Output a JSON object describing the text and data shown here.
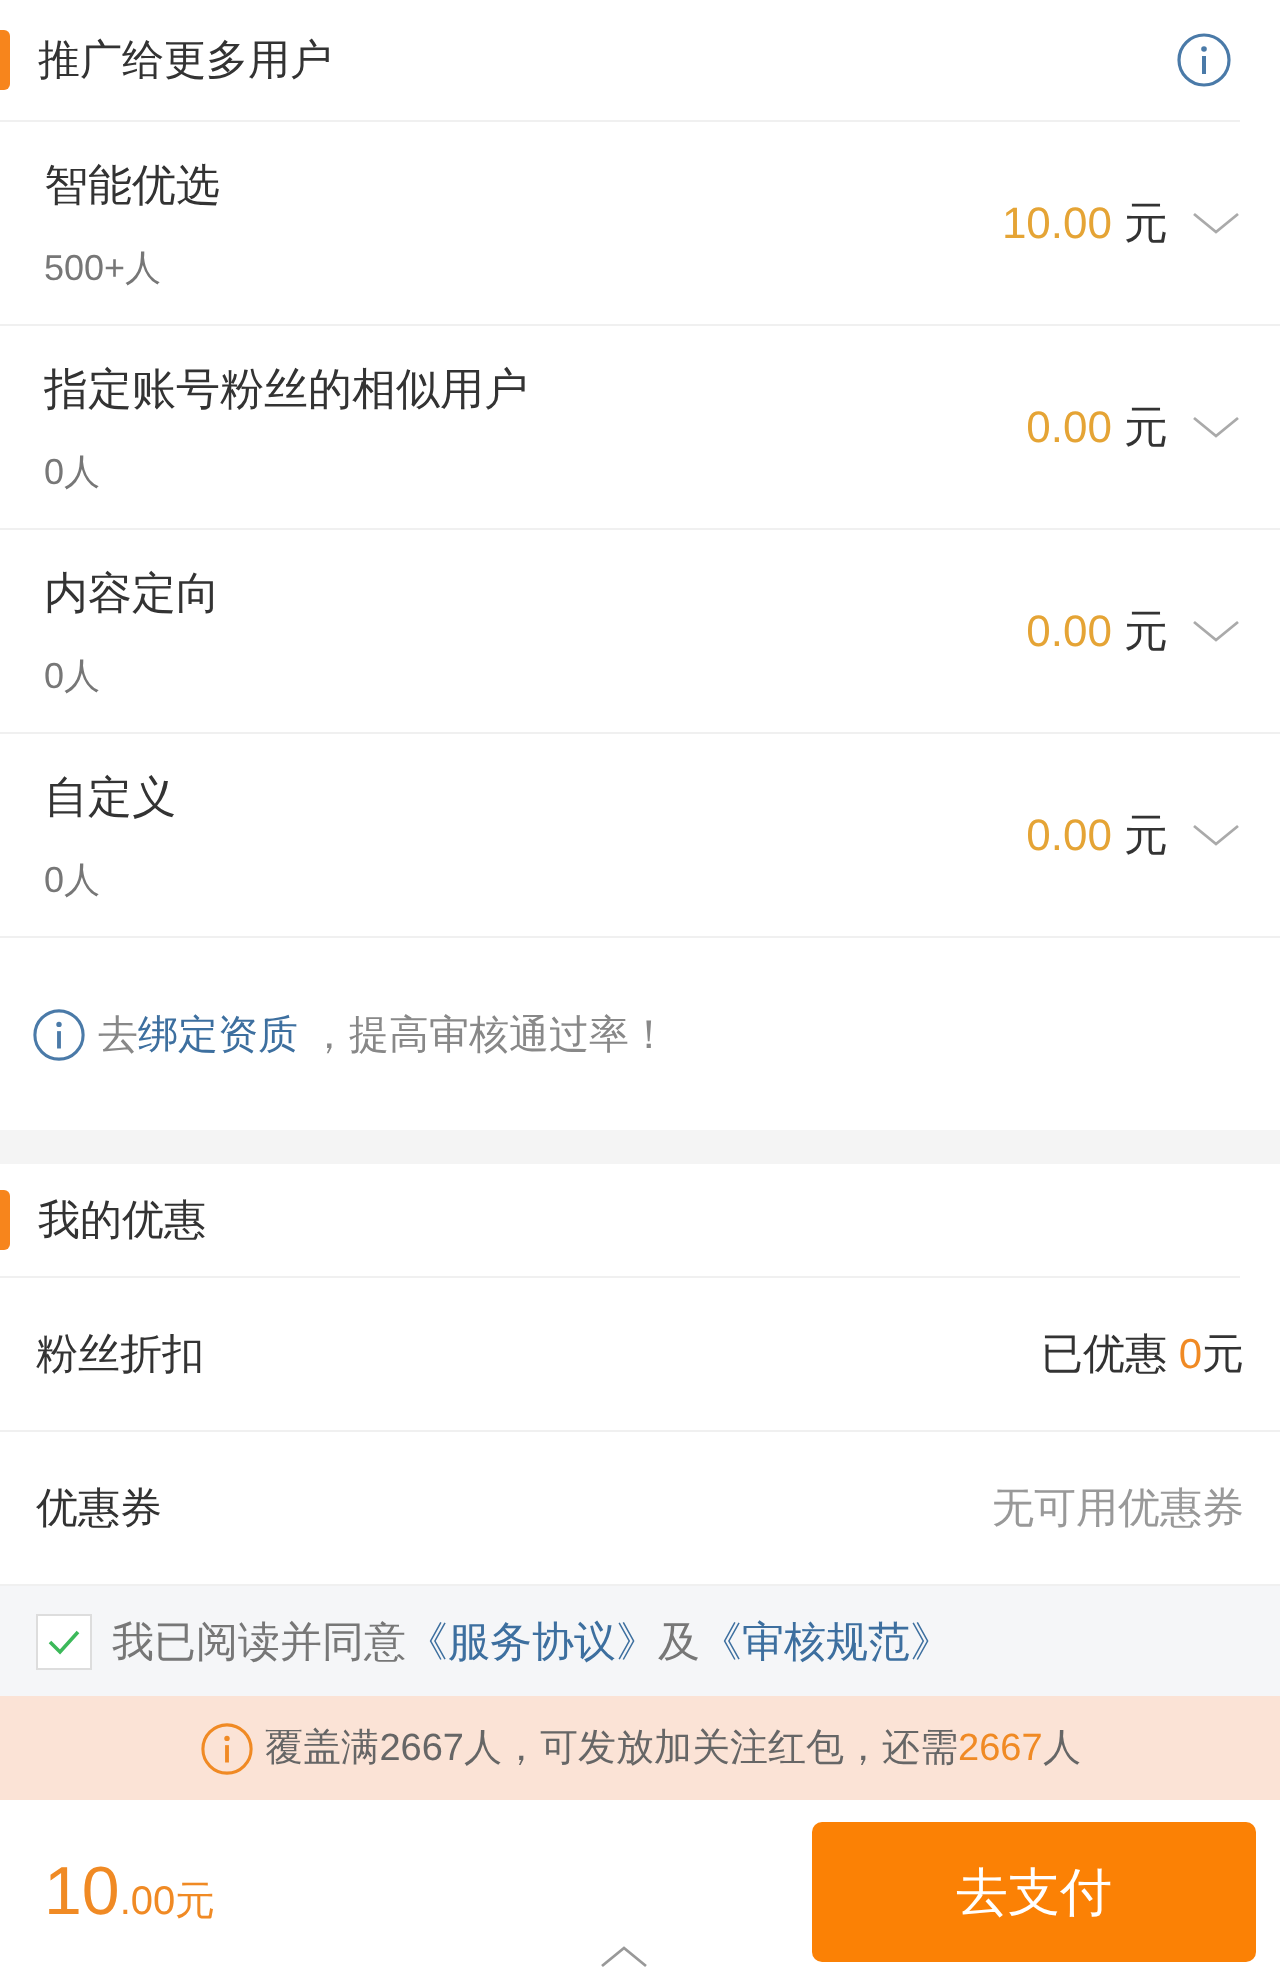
{
  "promote": {
    "title": "推广给更多用户",
    "options": [
      {
        "name": "智能优选",
        "count": "500+人",
        "amount": "10.00",
        "unit": "元"
      },
      {
        "name": "指定账号粉丝的相似用户",
        "count": "0人",
        "amount": "0.00",
        "unit": "元"
      },
      {
        "name": "内容定向",
        "count": "0人",
        "amount": "0.00",
        "unit": "元"
      },
      {
        "name": "自定义",
        "count": "0人",
        "amount": "0.00",
        "unit": "元"
      }
    ],
    "tip": {
      "prefix": "去",
      "link": "绑定资质",
      "suffix": " ，提高审核通过率！"
    }
  },
  "discounts": {
    "title": "我的优惠",
    "rows": [
      {
        "label": "粉丝折扣",
        "kind": "amount",
        "prefix": "已优惠 ",
        "amount": "0",
        "unit": "元"
      },
      {
        "label": "优惠券",
        "kind": "note",
        "note": "无可用优惠券"
      }
    ]
  },
  "agreement": {
    "checked": true,
    "text": "我已阅读并同意",
    "link1": "《服务协议》",
    "joiner": "及",
    "link2": "《审核规范》"
  },
  "notice": {
    "text": "覆盖满2667人，可发放加关注红包，还需",
    "highlight": "2667",
    "suffix": "人"
  },
  "footer": {
    "total_int": "10",
    "total_dec": ".00元",
    "pay_button": "去支付"
  }
}
